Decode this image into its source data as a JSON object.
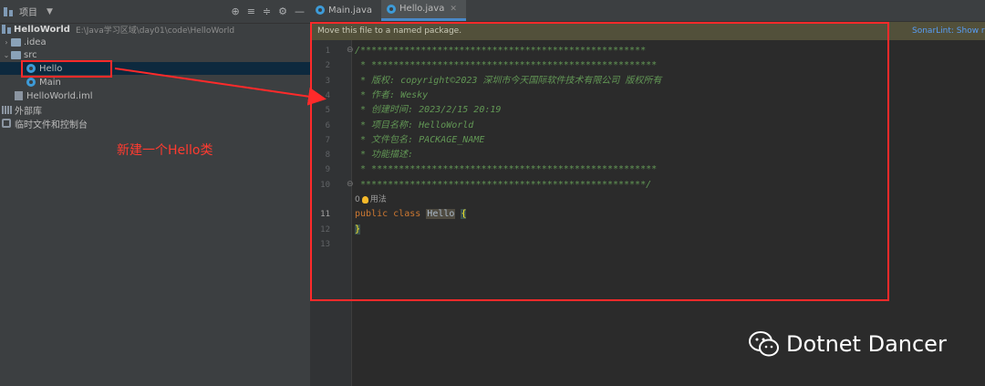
{
  "project_panel": {
    "title": "项目",
    "tree": {
      "root_name": "HelloWorld",
      "root_path": "E:\\Java学习区域\\day01\\code\\HelloWorld",
      "idea": ".idea",
      "src": "src",
      "hello": "Hello",
      "main": "Main",
      "iml": "HelloWorld.iml",
      "external_libs": "外部库",
      "scratches": "临时文件和控制台"
    },
    "annotation": "新建一个Hello类"
  },
  "tabs": [
    {
      "label": "Main.java",
      "active": false
    },
    {
      "label": "Hello.java",
      "active": true
    }
  ],
  "banner": {
    "message": "Move this file to a named package.",
    "link": "SonarLint: Show ru"
  },
  "editor": {
    "line_numbers": [
      "1",
      "2",
      "3",
      "4",
      "5",
      "6",
      "7",
      "8",
      "9",
      "10",
      "11",
      "12",
      "13"
    ],
    "comment_lines": [
      "/****************************************************",
      " * ****************************************************",
      " * 版权: copyright©2023 深圳市今天国际软件技术有限公司 版权所有",
      " * 作者: Wesky",
      " * 创建时间: 2023/2/15 20:19",
      " * 项目名称: HelloWorld",
      " * 文件包名: PACKAGE_NAME",
      " * 功能描述:",
      " * ****************************************************",
      " ****************************************************/"
    ],
    "usage_hint": "0",
    "usage_label": "用法",
    "keyword_public": "public",
    "keyword_class": "class",
    "class_name": "Hello",
    "open_brace": "{",
    "close_brace": "}"
  },
  "watermark": {
    "text": "Dotnet Dancer"
  },
  "colors": {
    "annotation_red": "#ff2a2a",
    "comment_green": "#629755",
    "keyword_orange": "#cc7832",
    "banner_bg": "#52503a",
    "link_blue": "#589df6"
  }
}
